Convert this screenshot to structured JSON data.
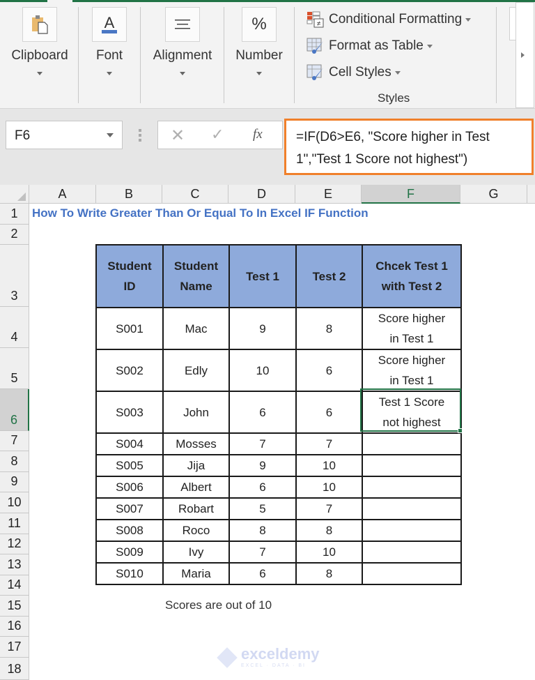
{
  "ribbon": {
    "groups": [
      {
        "label": "Clipboard",
        "icon": "clipboard-icon"
      },
      {
        "label": "Font",
        "icon": "font-color-icon"
      },
      {
        "label": "Alignment",
        "icon": "align-icon"
      },
      {
        "label": "Number",
        "icon": "percent-icon",
        "glyph": "%"
      }
    ],
    "styles": {
      "items": [
        {
          "label": "Conditional Formatting",
          "icon": "conditional-formatting-icon"
        },
        {
          "label": "Format as Table",
          "icon": "format-as-table-icon"
        },
        {
          "label": "Cell Styles",
          "icon": "cell-styles-icon"
        }
      ],
      "group_label": "Styles"
    },
    "accent": "#217346"
  },
  "formula_bar": {
    "name_box": "F6",
    "cancel_glyph": "✕",
    "enter_glyph": "✓",
    "fx_label": "fx",
    "formula_line1": "=IF(D6>E6, \"Score higher in Test",
    "formula_line2": "1\",\"Test 1 Score not highest\")",
    "highlight_color": "#f0802b"
  },
  "grid": {
    "columns": [
      "A",
      "B",
      "C",
      "D",
      "E",
      "F",
      "G"
    ],
    "selected_column": "F",
    "rows": [
      "1",
      "2",
      "3",
      "4",
      "5",
      "6",
      "7",
      "8",
      "9",
      "10",
      "11",
      "12",
      "13",
      "14",
      "15",
      "16",
      "17",
      "18"
    ],
    "selected_row": "6",
    "title": "How To Write Greater Than Or Equal To In Excel IF Function",
    "title_color": "#4472c4"
  },
  "table": {
    "header_fill": "#8eaadb",
    "headers": [
      [
        "Student",
        "ID"
      ],
      [
        "Student",
        "Name"
      ],
      [
        "Test 1"
      ],
      [
        "Test 2"
      ],
      [
        "Chcek Test 1",
        "with Test 2"
      ]
    ],
    "rows": [
      {
        "id": "S001",
        "name": "Mac",
        "test1": "9",
        "test2": "8",
        "check": [
          "Score higher",
          "in Test 1"
        ]
      },
      {
        "id": "S002",
        "name": "Edly",
        "test1": "10",
        "test2": "6",
        "check": [
          "Score higher",
          "in Test 1"
        ]
      },
      {
        "id": "S003",
        "name": "John",
        "test1": "6",
        "test2": "6",
        "check": [
          "Test 1 Score",
          "not highest"
        ]
      },
      {
        "id": "S004",
        "name": "Mosses",
        "test1": "7",
        "test2": "7",
        "check": []
      },
      {
        "id": "S005",
        "name": "Jija",
        "test1": "9",
        "test2": "10",
        "check": []
      },
      {
        "id": "S006",
        "name": "Albert",
        "test1": "6",
        "test2": "10",
        "check": []
      },
      {
        "id": "S007",
        "name": "Robart",
        "test1": "5",
        "test2": "7",
        "check": []
      },
      {
        "id": "S008",
        "name": "Roco",
        "test1": "8",
        "test2": "8",
        "check": []
      },
      {
        "id": "S009",
        "name": "Ivy",
        "test1": "7",
        "test2": "10",
        "check": []
      },
      {
        "id": "S010",
        "name": "Maria",
        "test1": "6",
        "test2": "8",
        "check": []
      }
    ]
  },
  "note": "Scores are out of 10",
  "watermark": {
    "name": "exceldemy",
    "tagline": "EXCEL · DATA · BI"
  }
}
